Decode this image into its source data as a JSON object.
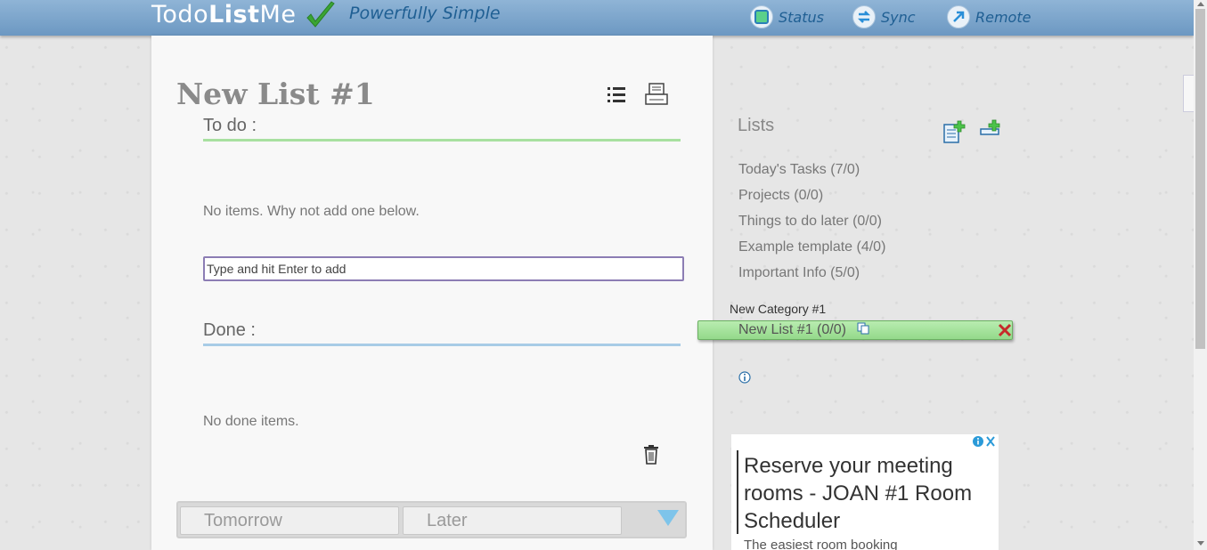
{
  "header": {
    "logo_light": "Todo",
    "logo_bold": "List",
    "logo_light2": "Me",
    "tagline": "Powerfully Simple",
    "nav": [
      {
        "label": "Status",
        "icon": "status-square-icon"
      },
      {
        "label": "Sync",
        "icon": "sync-arrows-icon"
      },
      {
        "label": "Remote",
        "icon": "remote-arrow-icon"
      }
    ]
  },
  "main": {
    "list_title": "New List #1",
    "todo_heading": "To do :",
    "todo_empty": "No items. Why not add one below.",
    "add_placeholder": "Type and hit Enter to add",
    "done_heading": "Done :",
    "done_empty": "No done items.",
    "tabs": [
      "Tomorrow",
      "Later"
    ]
  },
  "sidebar": {
    "title": "Lists",
    "lists": [
      "Today's Tasks (7/0)",
      "Projects (0/0)",
      "Things to do later (0/0)",
      "Example template (4/0)",
      "Important Info (5/0)"
    ],
    "category": "New Category #1",
    "active_list": "New List #1 (0/0)"
  },
  "ad": {
    "headline": "Reserve your meeting rooms - JOAN #1 Room Scheduler",
    "sub": "The easiest room booking"
  },
  "colors": {
    "header": "#7aa6cf",
    "todo_line": "#a8e0a0",
    "done_line": "#a8cce6",
    "active_list_bg": "#a6e39d"
  }
}
